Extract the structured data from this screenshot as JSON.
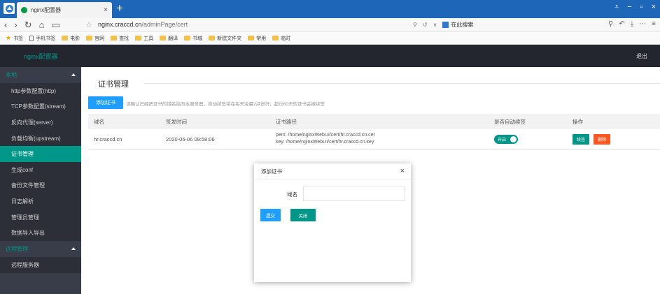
{
  "browser": {
    "tab_title": "nginx配置器",
    "tab_close": "×",
    "new_tab": "+",
    "url_host": "nginx.craccd.cn",
    "url_path": "/adminPage/cert",
    "search_engine": "在此搜索",
    "window_controls": [
      "⩡",
      "−",
      "▫",
      "×"
    ],
    "nav_buttons": [
      "‹",
      "›",
      "↻",
      "⌂",
      "▭"
    ],
    "star": "☆",
    "nav_right_icons": [
      "⚲",
      "↺",
      "∨"
    ],
    "nav_tools": [
      "⚲",
      "↶",
      "⤓",
      "⋯",
      "≡"
    ]
  },
  "bookmarks": [
    {
      "label": "书签",
      "icon": "star"
    },
    {
      "label": "手机书签",
      "icon": "phone"
    },
    {
      "label": "电影",
      "icon": "folder"
    },
    {
      "label": "官网",
      "icon": "folder"
    },
    {
      "label": "查找",
      "icon": "folder"
    },
    {
      "label": "工具",
      "icon": "folder"
    },
    {
      "label": "翻译",
      "icon": "folder"
    },
    {
      "label": "书城",
      "icon": "folder"
    },
    {
      "label": "新建文件夹",
      "icon": "folder"
    },
    {
      "label": "常用",
      "icon": "folder"
    },
    {
      "label": "临时",
      "icon": "folder"
    }
  ],
  "header": {
    "logo": "nginx配置器",
    "logout": "退出"
  },
  "sidebar": {
    "group_local": "本地",
    "items": [
      "http参数配置(http)",
      "TCP参数配置(stream)",
      "反向代理(server)",
      "负载均衡(upstream)",
      "证书管理",
      "生成conf",
      "备份文件管理",
      "日志解析",
      "管理员管理",
      "数据导入导出"
    ],
    "group_remote": "远程管理",
    "remote_items": [
      "远程服务器"
    ]
  },
  "main": {
    "title": "证书管理",
    "add_button": "添加证书",
    "hint": "请确认已经把证书的域名指向本服务器，自动续签将在每天凌晨2点进行，超过60天的证书会被续签",
    "table": {
      "headers": [
        "域名",
        "签发时间",
        "证书路径",
        "是否自动续签",
        "操作"
      ],
      "rows": [
        {
          "domain": "hr.craccd.cn",
          "issued": "2020-06-06 09:58:06",
          "pem": "pem: /home/nginxWebUI/cert/hr.craccd.cn.cer",
          "key": "key: /home/nginxWebUI/cert/hr.craccd.cn.key",
          "auto_renew": "开启",
          "edit": "续签",
          "delete": "删除"
        }
      ]
    }
  },
  "modal": {
    "title": "添加证书",
    "close": "×",
    "domain_label": "域名",
    "domain_value": "",
    "submit": "提交",
    "cancel": "关闭"
  },
  "colors": {
    "titlebar": "#1d66b8",
    "header": "#23262e",
    "sidebar": "#393d49",
    "accent": "#009688",
    "primary": "#1e9fff",
    "danger": "#ff5722"
  }
}
